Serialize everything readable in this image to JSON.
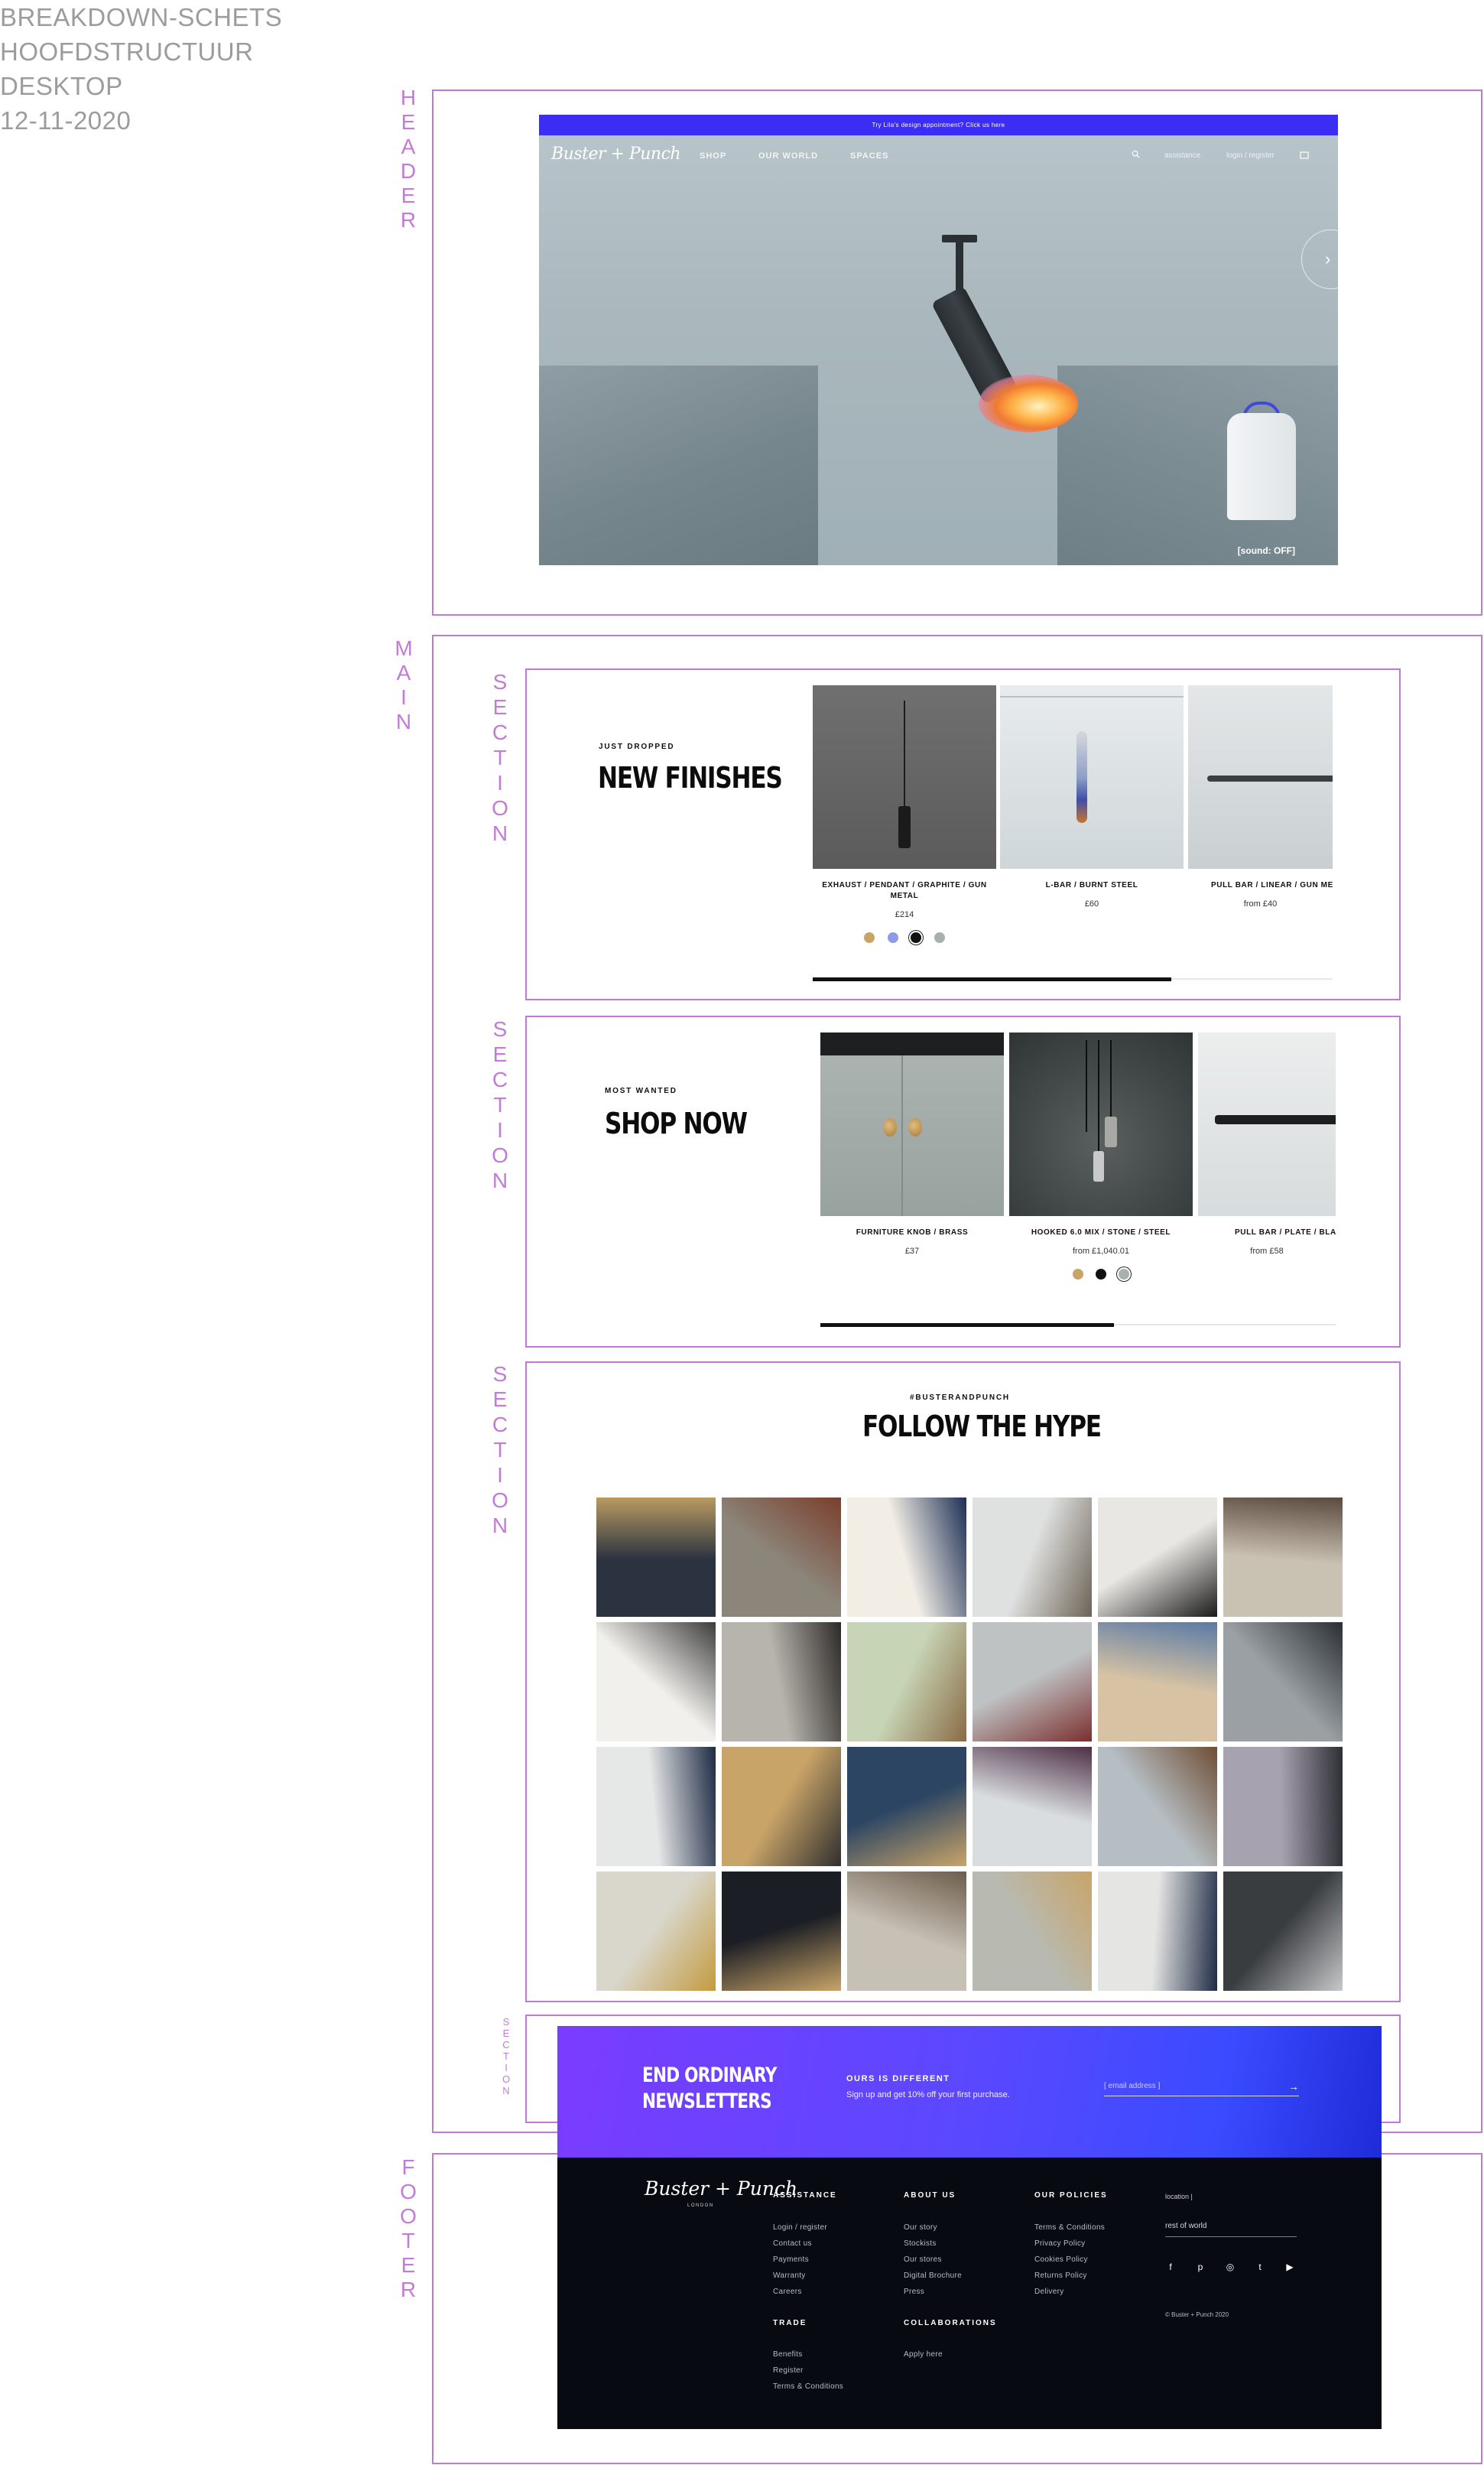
{
  "meta": {
    "lines": [
      "BREAKDOWN-SCHETS",
      "HOOFDSTRUCTUUR",
      "DESKTOP",
      "12-11-2020"
    ]
  },
  "labels": {
    "header": "HEADER",
    "main": "MAIN",
    "section": "SECTION",
    "footer": "FOOTER"
  },
  "header": {
    "announcement": "Try Lila's design appointment? Click us here",
    "logo": "Buster + Punch",
    "nav": [
      "SHOP",
      "OUR WORLD",
      "SPACES"
    ],
    "assistance": "assistance",
    "account": "login / register",
    "sound": "[sound: OFF]",
    "search_icon": "search-icon",
    "cart_icon": "cart-icon",
    "next_icon": "chevron-right-icon"
  },
  "section_finishes": {
    "pretitle": "JUST DROPPED",
    "title": "NEW FINISHES",
    "products": [
      {
        "name": "EXHAUST / PENDANT / GRAPHITE / GUN METAL",
        "price": "£214"
      },
      {
        "name": "L-BAR / BURNT STEEL",
        "price": "£60"
      },
      {
        "name": "PULL BAR / LINEAR / GUN ME",
        "price": "from £40"
      }
    ],
    "swatches": [
      "#c9a468",
      "#8c9ae8",
      "#111111",
      "#a9b0b0"
    ],
    "progress": 0.69
  },
  "section_shop": {
    "pretitle": "MOST WANTED",
    "title": "SHOP NOW",
    "products": [
      {
        "name": "FURNITURE KNOB / BRASS",
        "price": "£37"
      },
      {
        "name": "HOOKED 6.0 MIX / STONE / STEEL",
        "price": "from £1,040.01"
      },
      {
        "name": "PULL BAR / PLATE / BLA",
        "price": "from £58"
      }
    ],
    "swatches": [
      "#c9a468",
      "#111111",
      "#a9b0b0"
    ],
    "progress": 0.57
  },
  "section_hype": {
    "pretitle": "#BUSTERANDPUNCH",
    "title": "FOLLOW THE HYPE",
    "tiles": [
      {
        "alt": "dark kitchen cabinet handle",
        "c1": "#2b3340",
        "c2": "#b99a61"
      },
      {
        "alt": "marble counter towel bar",
        "c1": "#8c8579",
        "c2": "#7a3f2c"
      },
      {
        "alt": "navy kitchen brass tap",
        "c1": "#f2eee6",
        "c2": "#1d2f55"
      },
      {
        "alt": "dining room pendants",
        "c1": "#dfe1e0",
        "c2": "#6d6355"
      },
      {
        "alt": "black pug",
        "c1": "#e9e7e3",
        "c2": "#1a1a1a"
      },
      {
        "alt": "french bulldog",
        "c1": "#c9c1b2",
        "c2": "#5b4a3e"
      },
      {
        "alt": "white kitchen island",
        "c1": "#f1f0ec",
        "c2": "#3d3d3d"
      },
      {
        "alt": "fluted glass door",
        "c1": "#b7b4ad",
        "c2": "#2d2b28"
      },
      {
        "alt": "green kitchen",
        "c1": "#c7d4b5",
        "c2": "#8a6b44"
      },
      {
        "alt": "bar with stools",
        "c1": "#bfc2c3",
        "c2": "#7b2f2f"
      },
      {
        "alt": "wooden door with knob",
        "c1": "#d7c3a4",
        "c2": "#5a7aa5"
      },
      {
        "alt": "grey bedroom",
        "c1": "#9aa0a4",
        "c2": "#2b2f33"
      },
      {
        "alt": "bathroom vanity",
        "c1": "#e6e8e8",
        "c2": "#1e2a44"
      },
      {
        "alt": "brass bar handles",
        "c1": "#c9a468",
        "c2": "#2f2f2f"
      },
      {
        "alt": "blue box packaging",
        "c1": "#2c4563",
        "c2": "#c9a468"
      },
      {
        "alt": "sketch on paper",
        "c1": "#d9dde0",
        "c2": "#4d2f45"
      },
      {
        "alt": "grey kitchen dining",
        "c1": "#b6bec3",
        "c2": "#6e4e35"
      },
      {
        "alt": "lilac bedroom",
        "c1": "#a7a2b0",
        "c2": "#2e2f36"
      },
      {
        "alt": "glass shelf brass",
        "c1": "#d9d7cc",
        "c2": "#c39b3f"
      },
      {
        "alt": "brass knobs on black",
        "c1": "#1b1e24",
        "c2": "#c9a468"
      },
      {
        "alt": "bedroom with lamp",
        "c1": "#c6c0b5",
        "c2": "#6d5d4b"
      },
      {
        "alt": "hand opening drawer",
        "c1": "#b8bab1",
        "c2": "#c9a468"
      },
      {
        "alt": "navy kitchen with pendants",
        "c1": "#e5e5e3",
        "c2": "#1f2c46"
      },
      {
        "alt": "steel pull bars",
        "c1": "#3a3d40",
        "c2": "#c6c8c9"
      }
    ]
  },
  "newsletter": {
    "title_line1": "END ORDINARY",
    "title_line2": "NEWSLETTERS",
    "pretitle": "OURS IS DIFFERENT",
    "copy": "Sign up and get 10% off your first purchase.",
    "placeholder": "[ email address ]",
    "submit_icon": "arrow-right-icon"
  },
  "footer": {
    "logo": "Buster + Punch",
    "logo_sub": "LONDON",
    "assistance": {
      "heading": "ASSISTANCE",
      "links": [
        "Login / register",
        "Contact us",
        "Payments",
        "Warranty",
        "Careers"
      ]
    },
    "about": {
      "heading": "ABOUT US",
      "links": [
        "Our story",
        "Stockists",
        "Our stores",
        "Digital Brochure",
        "Press"
      ]
    },
    "policies": {
      "heading": "OUR POLICIES",
      "links": [
        "Terms & Conditions",
        "Privacy Policy",
        "Cookies Policy",
        "Returns Policy",
        "Delivery"
      ]
    },
    "trade": {
      "heading": "TRADE",
      "links": [
        "Benefits",
        "Register",
        "Terms & Conditions"
      ]
    },
    "collaborations": {
      "heading": "COLLABORATIONS",
      "links": [
        "Apply here"
      ]
    },
    "location_label": "location |",
    "location_value": "rest of world",
    "social": [
      "f",
      "p",
      "◎",
      "t",
      "▶"
    ],
    "copyright": "© Buster + Punch 2020"
  }
}
